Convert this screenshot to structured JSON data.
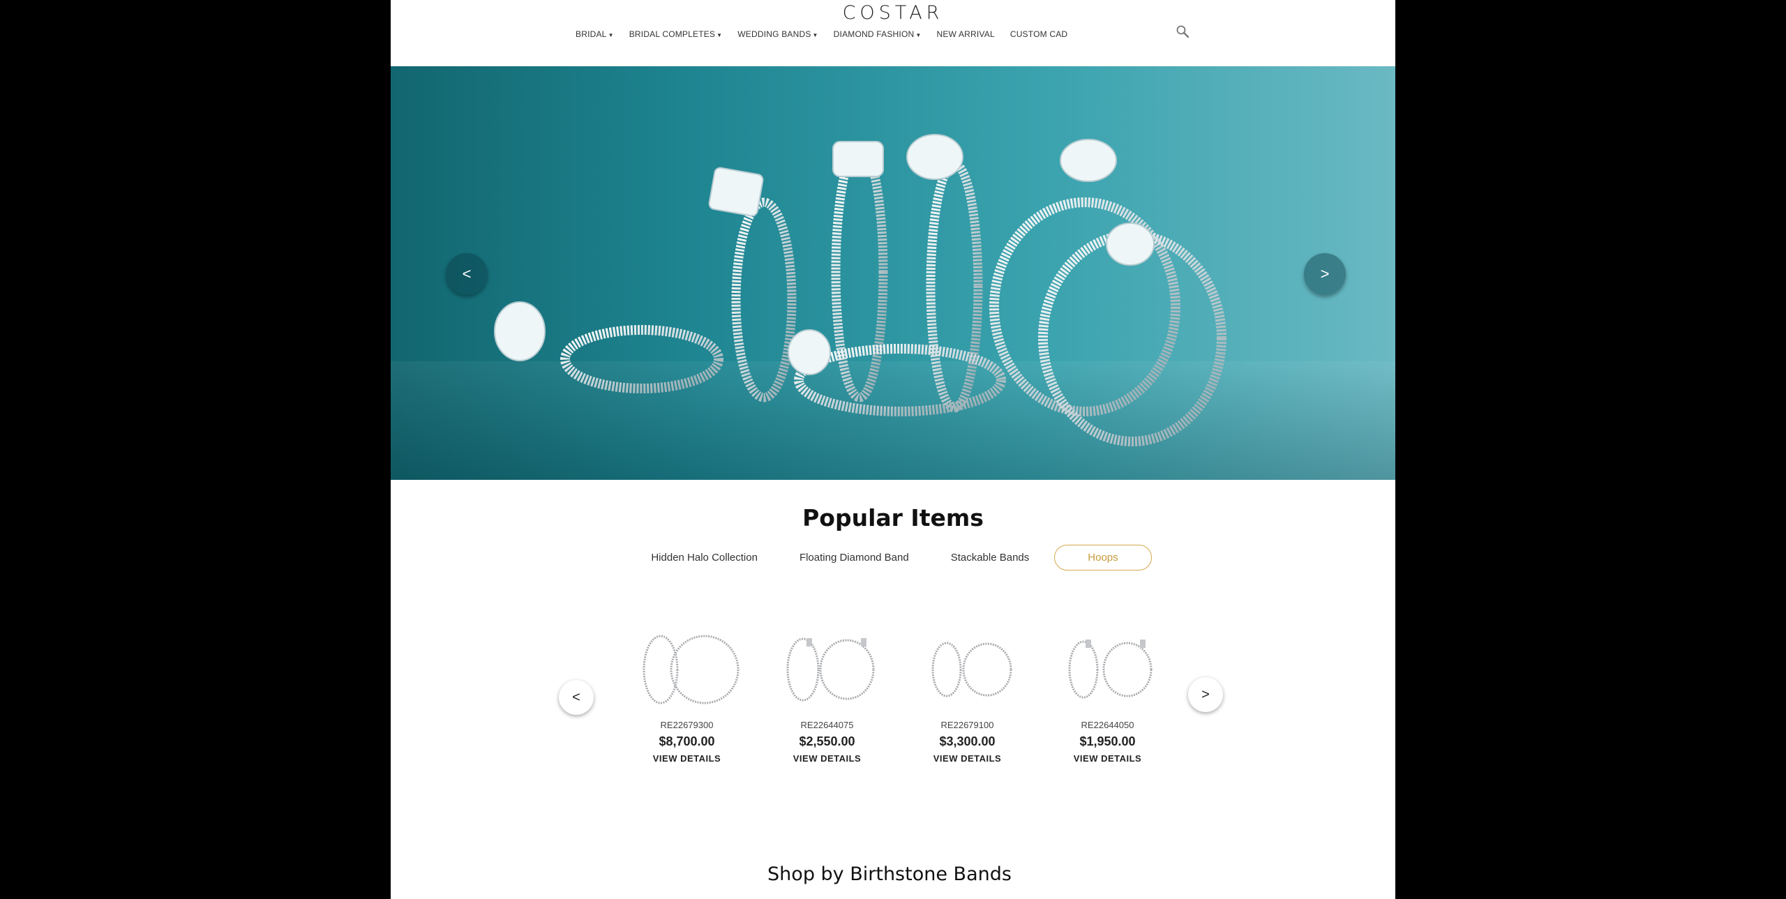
{
  "header": {
    "logo": "COSTAR",
    "nav": [
      {
        "label": "BRIDAL",
        "dropdown": true
      },
      {
        "label": "BRIDAL COMPLETES",
        "dropdown": true
      },
      {
        "label": "WEDDING BANDS",
        "dropdown": true
      },
      {
        "label": "DIAMOND FASHION",
        "dropdown": true
      },
      {
        "label": "NEW ARRIVAL",
        "dropdown": false
      },
      {
        "label": "CUSTOM CAD",
        "dropdown": false
      }
    ],
    "search_icon": "search-icon"
  },
  "hero": {
    "prev_symbol": "<",
    "next_symbol": ">"
  },
  "popular": {
    "title": "Popular Items",
    "tabs": [
      {
        "label": "Hidden Halo Collection",
        "active": false
      },
      {
        "label": "Floating Diamond Band",
        "active": false
      },
      {
        "label": "Stackable Bands",
        "active": false
      },
      {
        "label": "Hoops",
        "active": true
      }
    ],
    "products": [
      {
        "sku": "RE22679300",
        "price": "$8,700.00",
        "cta": "VIEW DETAILS"
      },
      {
        "sku": "RE22644075",
        "price": "$2,550.00",
        "cta": "VIEW DETAILS"
      },
      {
        "sku": "RE22679100",
        "price": "$3,300.00",
        "cta": "VIEW DETAILS"
      },
      {
        "sku": "RE22644050",
        "price": "$1,950.00",
        "cta": "VIEW DETAILS"
      }
    ],
    "prev_symbol": "<",
    "next_symbol": ">"
  },
  "birthstone": {
    "title": "Shop by Birthstone Bands"
  },
  "colors": {
    "accent": "#d4a84c",
    "hero": "#1e8591"
  }
}
